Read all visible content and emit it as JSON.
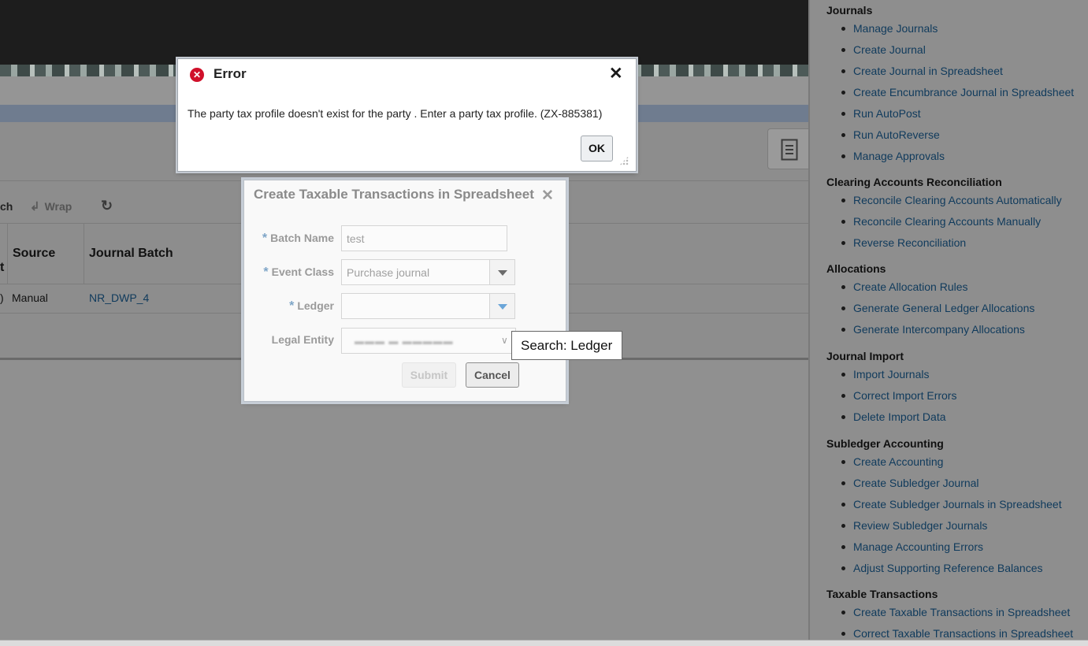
{
  "background": {
    "toolbar": {
      "fragment_label": "ch",
      "wrap_label": "Wrap"
    },
    "table": {
      "headers": [
        "Source",
        "Journal Batch"
      ],
      "partial_header": "t",
      "row": {
        "partial_cell": ")",
        "source": "Manual",
        "journal_batch": "NR_DWP_4"
      }
    }
  },
  "task_panel": {
    "groups": [
      {
        "title": "Journals",
        "items": [
          "Manage Journals",
          "Create Journal",
          "Create Journal in Spreadsheet",
          "Create Encumbrance Journal in Spreadsheet",
          "Run AutoPost",
          "Run AutoReverse",
          "Manage Approvals"
        ]
      },
      {
        "title": "Clearing Accounts Reconciliation",
        "items": [
          "Reconcile Clearing Accounts Automatically",
          "Reconcile Clearing Accounts Manually",
          "Reverse Reconciliation"
        ]
      },
      {
        "title": "Allocations",
        "items": [
          "Create Allocation Rules",
          "Generate General Ledger Allocations",
          "Generate Intercompany Allocations"
        ]
      },
      {
        "title": "Journal Import",
        "items": [
          "Import Journals",
          "Correct Import Errors",
          "Delete Import Data"
        ]
      },
      {
        "title": "Subledger Accounting",
        "items": [
          "Create Accounting",
          "Create Subledger Journal",
          "Create Subledger Journals in Spreadsheet",
          "Review Subledger Journals",
          "Manage Accounting Errors",
          "Adjust Supporting Reference Balances"
        ]
      },
      {
        "title": "Taxable Transactions",
        "items": [
          "Create Taxable Transactions in Spreadsheet",
          "Correct Taxable Transactions in Spreadsheet"
        ]
      }
    ]
  },
  "ctt_dialog": {
    "title": "Create Taxable Transactions in Spreadsheet",
    "required_marker": "*",
    "fields": {
      "batch_name": {
        "label": "Batch Name",
        "value": "test"
      },
      "event_class": {
        "label": "Event Class",
        "value": "Purchase journal"
      },
      "ledger": {
        "label": "Ledger"
      },
      "legal_entity": {
        "label": "Legal Entity"
      }
    },
    "submit_label": "Submit",
    "cancel_label": "Cancel"
  },
  "tooltip": {
    "text": "Search: Ledger"
  },
  "error_dialog": {
    "title": "Error",
    "message": "The party tax profile doesn't exist for the party . Enter a party tax profile. (ZX-885381)",
    "ok_label": "OK"
  },
  "colors": {
    "link": "#0f3a5c",
    "error_icon": "#d0102a",
    "required_marker": "#7ea5c7"
  }
}
